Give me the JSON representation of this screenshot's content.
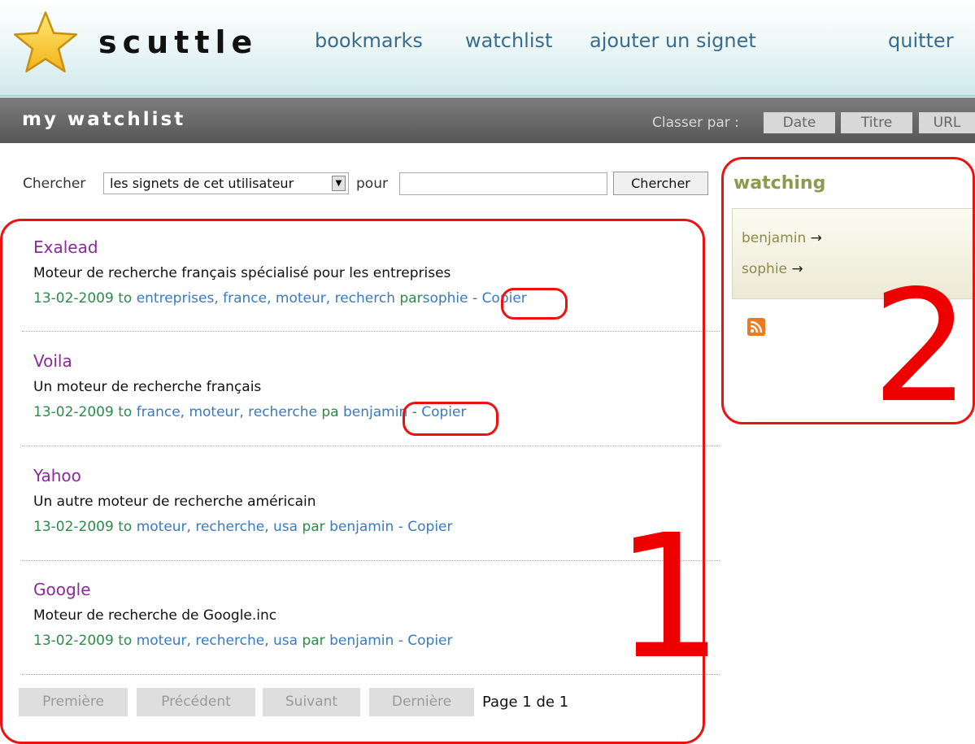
{
  "header": {
    "site_name": "scuttle",
    "nav": [
      "bookmarks",
      "watchlist",
      "ajouter un signet"
    ],
    "quit": "quitter"
  },
  "titlebar": {
    "title": "my watchlist",
    "sort_label": "Classer par :",
    "sort_options": [
      "Date",
      "Titre",
      "URL"
    ]
  },
  "search": {
    "label": "Chercher",
    "scope": "les signets de cet utilisateur",
    "for_label": "pour",
    "query": "",
    "button": "Chercher"
  },
  "bookmarks": [
    {
      "title": "Exalead",
      "description": "Moteur de recherche français spécialisé pour les entreprises",
      "date": "13-02-2009",
      "to": "to",
      "tags": "entreprises, france, moteur, recherch",
      "par": "par",
      "user": "sophie",
      "dash": "-",
      "copy": "Copier"
    },
    {
      "title": "Voila",
      "description": "Un moteur de recherche français",
      "date": "13-02-2009",
      "to": "to",
      "tags": "france, moteur, recherche",
      "par": "pa",
      "user": "benjamin",
      "dash": "-",
      "copy": "Copier"
    },
    {
      "title": "Yahoo",
      "description": "Un autre moteur de recherche américain",
      "date": "13-02-2009",
      "to": "to",
      "tags": "moteur, recherche, usa",
      "par": "par",
      "user": "benjamin",
      "dash": "-",
      "copy": "Copier"
    },
    {
      "title": "Google",
      "description": "Moteur de recherche de Google.inc",
      "date": "13-02-2009",
      "to": "to",
      "tags": "moteur, recherche, usa",
      "par": "par",
      "user": "benjamin",
      "dash": "-",
      "copy": "Copier"
    }
  ],
  "pagination": {
    "first": "Première",
    "prev": "Précédent",
    "next": "Suivant",
    "last": "Dernière",
    "info": "Page 1 de 1"
  },
  "sidebar": {
    "title": "watching",
    "users": [
      "benjamin",
      "sophie"
    ],
    "arrow": "→"
  },
  "annotations": {
    "one": "1",
    "two": "2"
  },
  "colors": {
    "annotation_red": "#e11111",
    "link_blue": "#3a6d8d",
    "title_purple": "#8c2a9a",
    "meta_green": "#2d8a49"
  }
}
